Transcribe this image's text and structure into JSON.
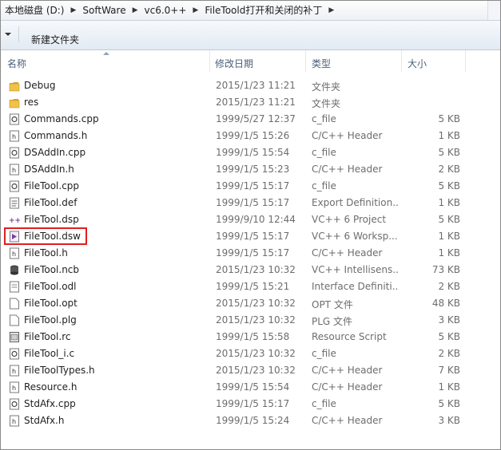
{
  "breadcrumb": [
    "本地磁盘 (D:)",
    "SoftWare",
    "vc6.0++",
    "FileToold打开和关闭的补丁"
  ],
  "toolbar": {
    "new_folder": "新建文件夹"
  },
  "columns": {
    "name": "名称",
    "date": "修改日期",
    "type": "类型",
    "size": "大小"
  },
  "files": [
    {
      "name": "Debug",
      "date": "2015/1/23 11:21",
      "type": "文件夹",
      "size": "",
      "icon": "folder-icon"
    },
    {
      "name": "res",
      "date": "2015/1/23 11:21",
      "type": "文件夹",
      "size": "",
      "icon": "folder-icon"
    },
    {
      "name": "Commands.cpp",
      "date": "1999/5/27 12:37",
      "type": "c_file",
      "size": "5 KB",
      "icon": "cpp-file-icon"
    },
    {
      "name": "Commands.h",
      "date": "1999/1/5 15:26",
      "type": "C/C++ Header",
      "size": "1 KB",
      "icon": "header-file-icon"
    },
    {
      "name": "DSAddIn.cpp",
      "date": "1999/1/5 15:54",
      "type": "c_file",
      "size": "5 KB",
      "icon": "cpp-file-icon"
    },
    {
      "name": "DSAddIn.h",
      "date": "1999/1/5 15:23",
      "type": "C/C++ Header",
      "size": "2 KB",
      "icon": "header-file-icon"
    },
    {
      "name": "FileTool.cpp",
      "date": "1999/1/5 15:17",
      "type": "c_file",
      "size": "5 KB",
      "icon": "cpp-file-icon"
    },
    {
      "name": "FileTool.def",
      "date": "1999/1/5 15:17",
      "type": "Export Definition...",
      "size": "1 KB",
      "icon": "def-file-icon"
    },
    {
      "name": "FileTool.dsp",
      "date": "1999/9/10 12:44",
      "type": "VC++ 6 Project",
      "size": "5 KB",
      "icon": "dsp-file-icon"
    },
    {
      "name": "FileTool.dsw",
      "date": "1999/1/5 15:17",
      "type": "VC++ 6 Worksp...",
      "size": "1 KB",
      "icon": "dsw-file-icon",
      "highlighted": true
    },
    {
      "name": "FileTool.h",
      "date": "1999/1/5 15:17",
      "type": "C/C++ Header",
      "size": "1 KB",
      "icon": "header-file-icon"
    },
    {
      "name": "FileTool.ncb",
      "date": "2015/1/23 10:32",
      "type": "VC++ Intellisens...",
      "size": "73 KB",
      "icon": "database-file-icon"
    },
    {
      "name": "FileTool.odl",
      "date": "1999/1/5 15:21",
      "type": "Interface Definiti...",
      "size": "2 KB",
      "icon": "odl-file-icon"
    },
    {
      "name": "FileTool.opt",
      "date": "2015/1/23 10:32",
      "type": "OPT 文件",
      "size": "48 KB",
      "icon": "blank-file-icon"
    },
    {
      "name": "FileTool.plg",
      "date": "2015/1/23 10:32",
      "type": "PLG 文件",
      "size": "3 KB",
      "icon": "blank-file-icon"
    },
    {
      "name": "FileTool.rc",
      "date": "1999/1/5 15:58",
      "type": "Resource Script",
      "size": "5 KB",
      "icon": "rc-file-icon"
    },
    {
      "name": "FileTool_i.c",
      "date": "2015/1/23 10:32",
      "type": "c_file",
      "size": "2 KB",
      "icon": "c-file-icon"
    },
    {
      "name": "FileToolTypes.h",
      "date": "2015/1/23 10:32",
      "type": "C/C++ Header",
      "size": "7 KB",
      "icon": "header-file-icon"
    },
    {
      "name": "Resource.h",
      "date": "1999/1/5 15:54",
      "type": "C/C++ Header",
      "size": "1 KB",
      "icon": "header-file-icon"
    },
    {
      "name": "StdAfx.cpp",
      "date": "1999/1/5 15:17",
      "type": "c_file",
      "size": "5 KB",
      "icon": "cpp-file-icon"
    },
    {
      "name": "StdAfx.h",
      "date": "1999/1/5 15:24",
      "type": "C/C++ Header",
      "size": "3 KB",
      "icon": "header-file-icon"
    }
  ],
  "colors": {
    "highlight": "#e01f1f",
    "header_text": "#4c607a",
    "folder": "#e8b93c"
  }
}
